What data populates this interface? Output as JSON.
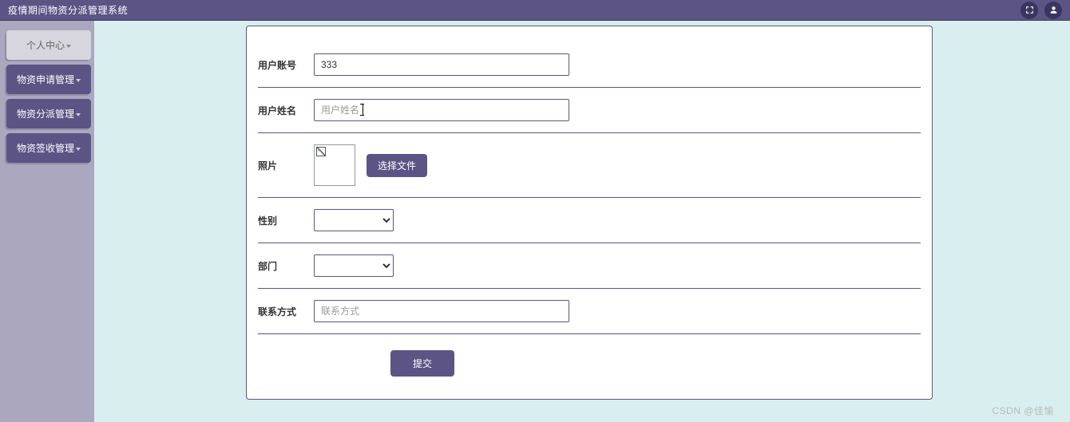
{
  "header": {
    "title": "疫情期间物资分派管理系统",
    "icons": [
      "fullscreen-icon",
      "user-icon"
    ]
  },
  "sidebar": {
    "items": [
      {
        "label": "个人中心",
        "variant": "light"
      },
      {
        "label": "物资申请管理",
        "variant": "dark"
      },
      {
        "label": "物资分派管理",
        "variant": "dark"
      },
      {
        "label": "物资签收管理",
        "variant": "dark"
      }
    ]
  },
  "form": {
    "account": {
      "label": "用户账号",
      "value": "333"
    },
    "name": {
      "label": "用户姓名",
      "placeholder": "用户姓名",
      "value": ""
    },
    "photo": {
      "label": "照片",
      "choose_label": "选择文件"
    },
    "gender": {
      "label": "性别",
      "selected": ""
    },
    "department": {
      "label": "部门",
      "selected": ""
    },
    "contact": {
      "label": "联系方式",
      "placeholder": "联系方式",
      "value": ""
    },
    "submit_label": "提交"
  },
  "watermark": "CSDN @佳愉"
}
